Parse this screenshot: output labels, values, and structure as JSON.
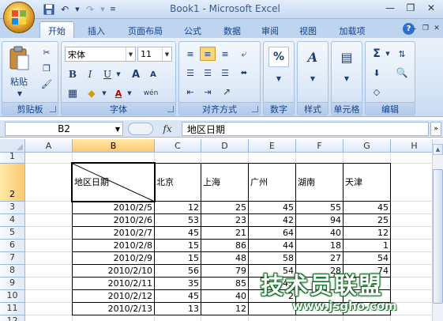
{
  "window": {
    "title": "Book1 - Microsoft Excel"
  },
  "tabs": [
    {
      "label": "开始",
      "active": true
    },
    {
      "label": "插入"
    },
    {
      "label": "页面布局"
    },
    {
      "label": "公式"
    },
    {
      "label": "数据"
    },
    {
      "label": "审阅"
    },
    {
      "label": "视图"
    },
    {
      "label": "加载项"
    }
  ],
  "ribbon": {
    "clipboard": {
      "label": "剪贴板",
      "paste": "粘贴"
    },
    "font": {
      "label": "字体",
      "font_name": "宋体",
      "font_size": "11",
      "bold": "B",
      "italic": "I",
      "underline": "U",
      "grow": "A",
      "shrink": "A",
      "font_color": "A",
      "phonetic": "wén"
    },
    "alignment": {
      "label": "对齐方式"
    },
    "number": {
      "label": "数字",
      "percent": "%"
    },
    "styles": {
      "label": "样式"
    },
    "cells": {
      "label": "单元格"
    },
    "editing": {
      "label": "编辑",
      "sum": "Σ"
    }
  },
  "formula_bar": {
    "name_box": "B2",
    "fx": "fx",
    "content": "地区日期"
  },
  "columns": [
    "A",
    "B",
    "C",
    "D",
    "E",
    "F",
    "G",
    "H"
  ],
  "selected_column": "B",
  "rows": [
    "1",
    "2",
    "3",
    "4",
    "5",
    "6",
    "7",
    "8",
    "9",
    "10",
    "11",
    "12"
  ],
  "selected_row": "2",
  "table": {
    "header": [
      "地区日期",
      "北京",
      "上海",
      "广州",
      "湖南",
      "天津"
    ],
    "data": [
      [
        "2010/2/5",
        "12",
        "25",
        "45",
        "55",
        "45"
      ],
      [
        "2010/2/6",
        "53",
        "23",
        "42",
        "94",
        "25"
      ],
      [
        "2010/2/7",
        "45",
        "21",
        "64",
        "40",
        "12"
      ],
      [
        "2010/2/8",
        "15",
        "86",
        "44",
        "18",
        "1"
      ],
      [
        "2010/2/9",
        "15",
        "48",
        "58",
        "27",
        "54"
      ],
      [
        "2010/2/10",
        "56",
        "79",
        "54",
        "28",
        "74"
      ],
      [
        "2010/2/11",
        "35",
        "85",
        "45",
        "",
        ""
      ],
      [
        "2010/2/12",
        "45",
        "40",
        "2",
        "",
        ""
      ],
      [
        "2010/2/13",
        "13",
        "12",
        "",
        "",
        ""
      ]
    ]
  },
  "watermark": {
    "text": "技术员联盟",
    "url": "www.jsgho.com"
  },
  "colors": {
    "accent": "#c5d8f1",
    "selection": "#fbc870"
  }
}
